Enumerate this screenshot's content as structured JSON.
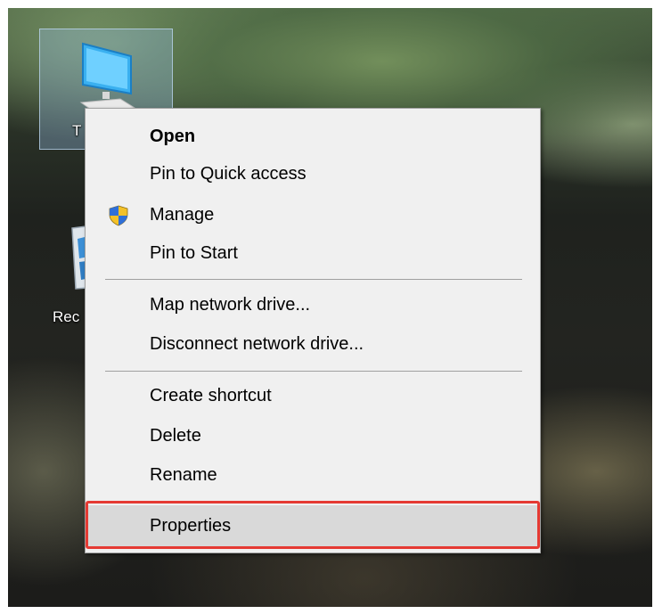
{
  "desktop": {
    "icons": [
      {
        "label": "T",
        "icon": "this-pc-icon"
      },
      {
        "label": "Rec",
        "icon": "recycle-bin-icon"
      }
    ]
  },
  "context_menu": {
    "items": [
      {
        "label": "Open",
        "bold": true
      },
      {
        "label": "Pin to Quick access"
      },
      {
        "label": "Manage",
        "icon": "uac-shield-icon"
      },
      {
        "label": "Pin to Start"
      },
      {
        "label": "Map network drive..."
      },
      {
        "label": "Disconnect network drive..."
      },
      {
        "label": "Create shortcut"
      },
      {
        "label": "Delete"
      },
      {
        "label": "Rename"
      },
      {
        "label": "Properties",
        "state": "hovered",
        "highlighted": true
      }
    ]
  },
  "colors": {
    "menu_background": "#f0f0f0",
    "hover_background": "#d9d9d9",
    "highlight_border": "#e53a33",
    "separator": "#a0a0a0"
  }
}
